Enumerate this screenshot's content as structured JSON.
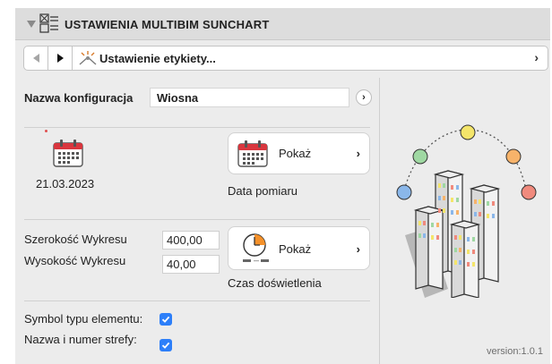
{
  "header": {
    "title": "USTAWIENIA MULTIBIM SUNCHART"
  },
  "navigation": {
    "page_label": "Ustawienie etykiety...",
    "chevron": "›"
  },
  "configuration": {
    "label": "Nazwa konfiguracja",
    "value": "Wiosna",
    "button_glyph": "›"
  },
  "measurement": {
    "date": "21.03.2023",
    "show_label": "Pokaż",
    "chevron": "›",
    "caption": "Data pomiaru"
  },
  "dimensions": {
    "width_label": "Szerokość Wykresu",
    "width_value": "400,00",
    "height_label": "Wysokość Wykresu",
    "height_value": "40,00"
  },
  "exposure": {
    "show_label": "Pokaż",
    "chevron": "›",
    "caption": "Czas doświetlenia"
  },
  "options": {
    "element_symbol_label": "Symbol typu elementu:",
    "element_symbol_checked": true,
    "zone_label": "Nazwa i numer strefy:",
    "zone_checked": true
  },
  "footer": {
    "version": "version:1.0.1"
  },
  "colors": {
    "accent_orange": "#f5912a",
    "checkbox_blue": "#2d7ff9",
    "calendar_red": "#d9363e"
  }
}
